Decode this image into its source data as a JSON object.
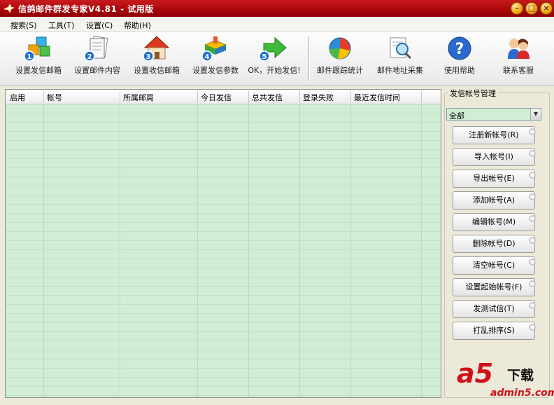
{
  "window": {
    "title": "信鸽邮件群发专家V4.81 - 试用版",
    "controls": {
      "minimize": "–",
      "maximize": "□",
      "close": "×"
    }
  },
  "menu": [
    {
      "label": "搜索(S)"
    },
    {
      "label": "工具(T)"
    },
    {
      "label": "设置(C)"
    },
    {
      "label": "帮助(H)"
    }
  ],
  "toolbar": [
    {
      "label": "设置发信邮箱",
      "icon": "cubes-icon",
      "step": "1"
    },
    {
      "label": "设置邮件内容",
      "icon": "document-icon",
      "step": "2"
    },
    {
      "label": "设置收信邮箱",
      "icon": "house-icon",
      "step": "3"
    },
    {
      "label": "设置发信参数",
      "icon": "blocks-icon",
      "step": "4"
    },
    {
      "label": "OK，开始发信!",
      "icon": "green-arrow-icon",
      "step": "5"
    },
    {
      "label": "邮件跟踪统计",
      "icon": "pie-chart-icon"
    },
    {
      "label": "邮件地址采集",
      "icon": "magnifier-icon"
    },
    {
      "label": "使用帮助",
      "icon": "help-icon"
    },
    {
      "label": "联系客服",
      "icon": "users-icon"
    }
  ],
  "table": {
    "columns": [
      "启用",
      "帐号",
      "所属邮局",
      "今日发信",
      "总共发信",
      "登录失败",
      "最近发信时间"
    ],
    "rows": []
  },
  "panel": {
    "title": "发信帐号管理",
    "filter_value": "全部",
    "buttons": [
      {
        "label": "注册新帐号(R)"
      },
      {
        "label": "导入帐号(I)"
      },
      {
        "label": "导出帐号(E)"
      },
      {
        "label": "添加帐号(A)"
      },
      {
        "label": "编辑帐号(M)"
      },
      {
        "label": "删除帐号(D)"
      },
      {
        "label": "清空帐号(C)"
      },
      {
        "label": "设置起始帐号(F)"
      },
      {
        "label": "发测试信(T)"
      },
      {
        "label": "打乱排序(S)"
      }
    ]
  },
  "watermark": {
    "logo": "a5",
    "word": "下载",
    "url": "admin5.com"
  },
  "colors": {
    "title_bar": "#b40c10",
    "grid": "#d1edd4",
    "accent_red": "#d0111b"
  }
}
